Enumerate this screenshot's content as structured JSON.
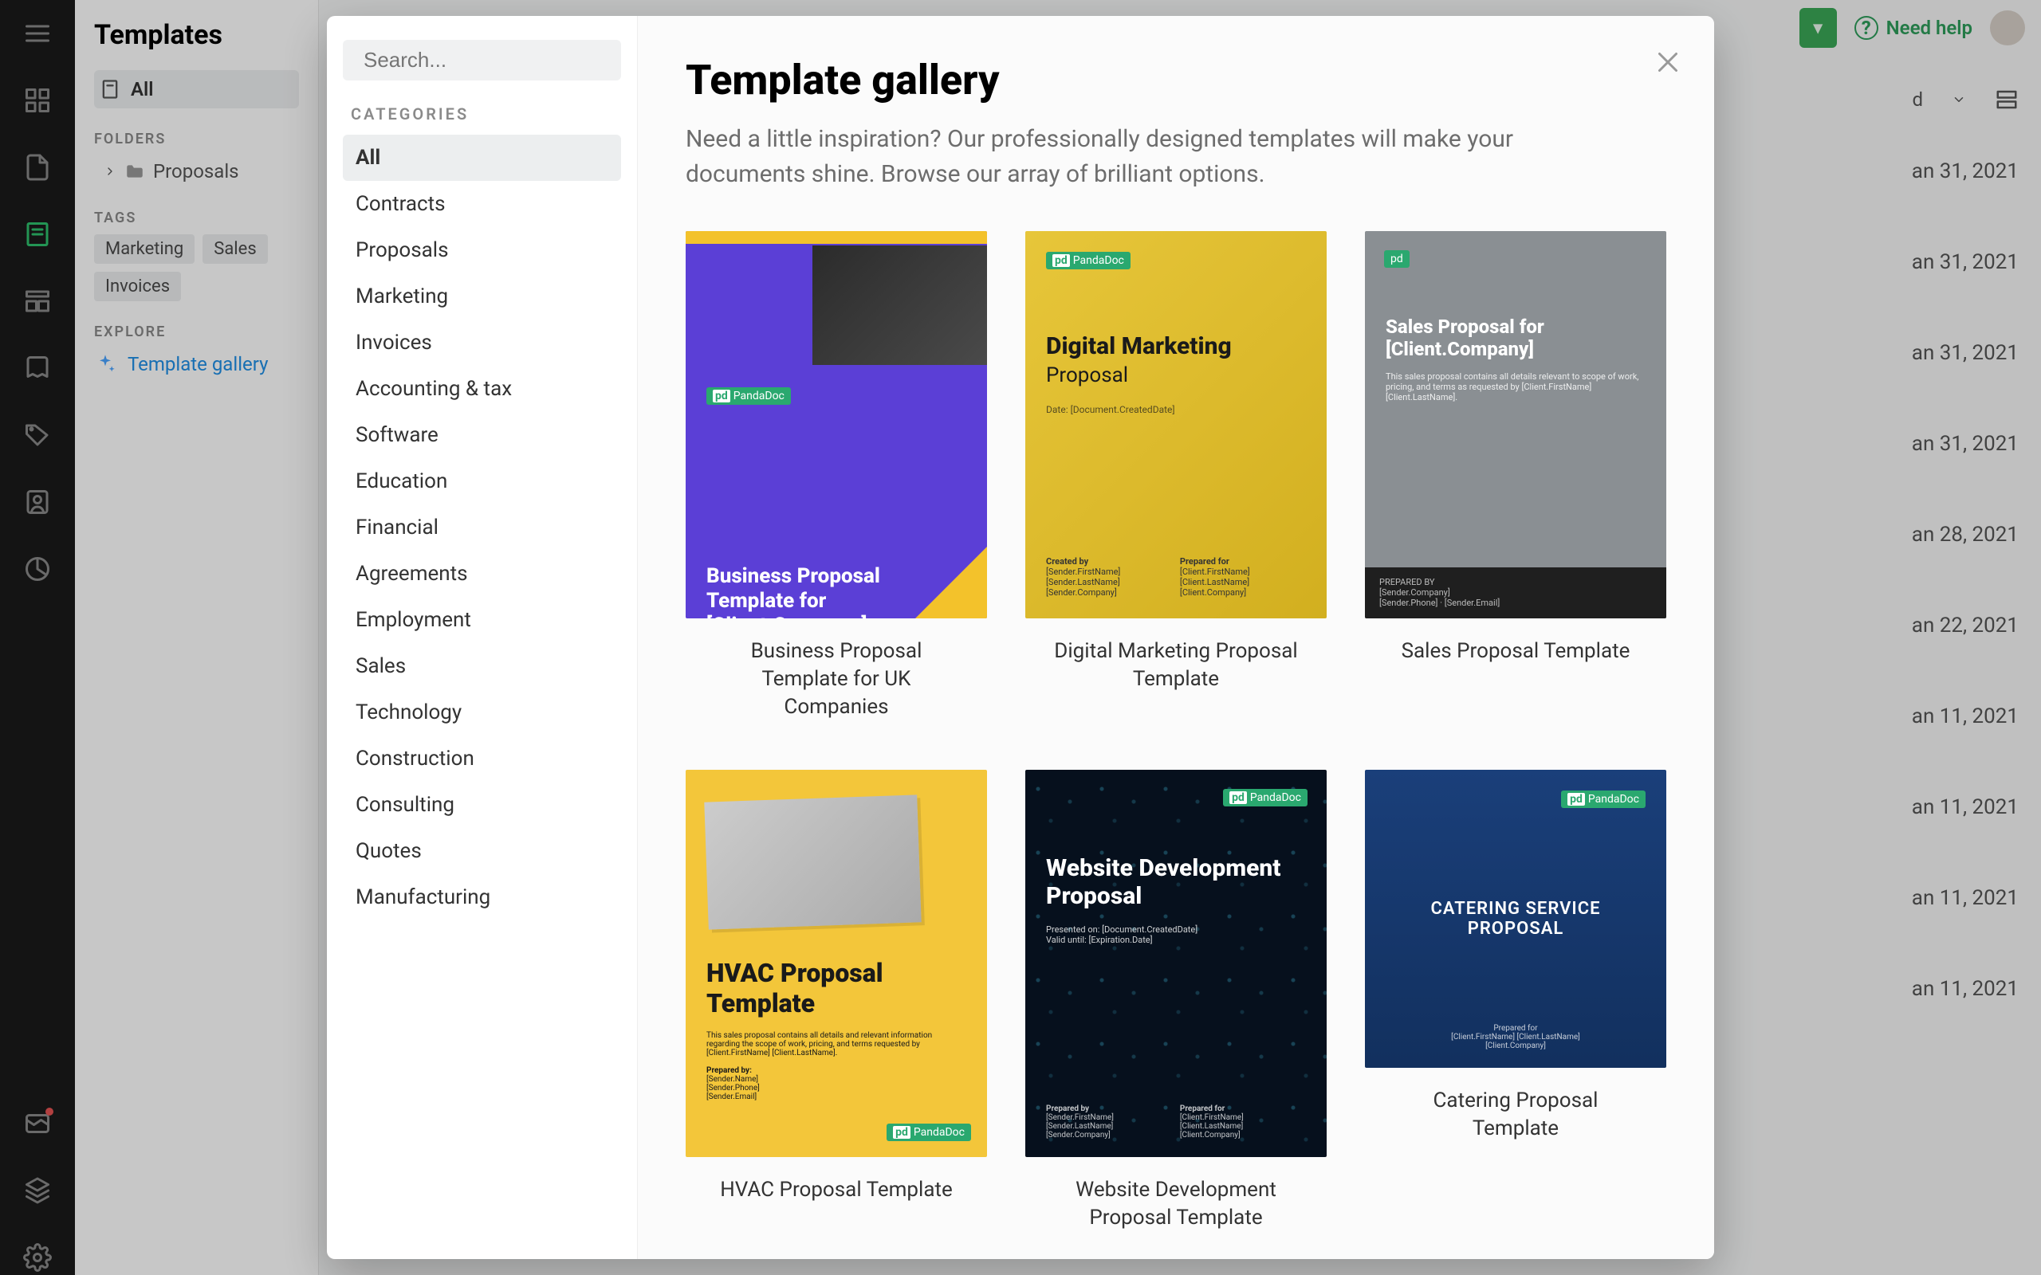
{
  "header": {
    "title": "Templates",
    "need_help": "Need help"
  },
  "rail_icons": [
    "menu",
    "dashboard",
    "documents",
    "templates",
    "forms",
    "library",
    "tags",
    "contacts",
    "reports",
    "inbox",
    "catalog",
    "settings"
  ],
  "panel": {
    "all_label": "All",
    "folders_label": "FOLDERS",
    "folders": [
      "Proposals"
    ],
    "tags_label": "TAGS",
    "tags": [
      "Marketing",
      "Sales",
      "Invoices"
    ],
    "explore_label": "EXPLORE",
    "template_gallery": "Template gallery"
  },
  "sort": {
    "label_prefix": "d",
    "icon": "chevron-down"
  },
  "dates": [
    "an 31, 2021",
    "an 31, 2021",
    "an 31, 2021",
    "an 31, 2021",
    "an 28, 2021",
    "an 22, 2021",
    "an 11, 2021",
    "an 11, 2021",
    "an 11, 2021",
    "an 11, 2021"
  ],
  "view_icon": "card-view",
  "modal": {
    "search_placeholder": "Search...",
    "categories_label": "CATEGORIES",
    "categories": [
      "All",
      "Contracts",
      "Proposals",
      "Marketing",
      "Invoices",
      "Accounting & tax",
      "Software",
      "Education",
      "Financial",
      "Agreements",
      "Employment",
      "Sales",
      "Technology",
      "Construction",
      "Consulting",
      "Quotes",
      "Manufacturing"
    ],
    "active_category": "All",
    "title": "Template gallery",
    "subtitle": "Need a little inspiration? Our professionally designed templates will make your documents shine. Browse our array of brilliant options.",
    "templates": [
      {
        "title": "Business Proposal Template for UK Companies",
        "thumb_h": "Business Proposal Template for [Client.Company]"
      },
      {
        "title": "Digital Marketing Proposal Template",
        "thumb_h": "Digital Marketing",
        "thumb_sub": "Proposal"
      },
      {
        "title": "Sales Proposal Template",
        "thumb_h": "Sales Proposal for [Client.Company]"
      },
      {
        "title": "HVAC Proposal Template",
        "thumb_h": "HVAC Proposal Template"
      },
      {
        "title": "Website Development Proposal Template",
        "thumb_h": "Website Development Proposal"
      },
      {
        "title": "Catering Proposal Template",
        "thumb_h": "CATERING SERVICE PROPOSAL"
      }
    ],
    "brand": "PandaDoc"
  }
}
